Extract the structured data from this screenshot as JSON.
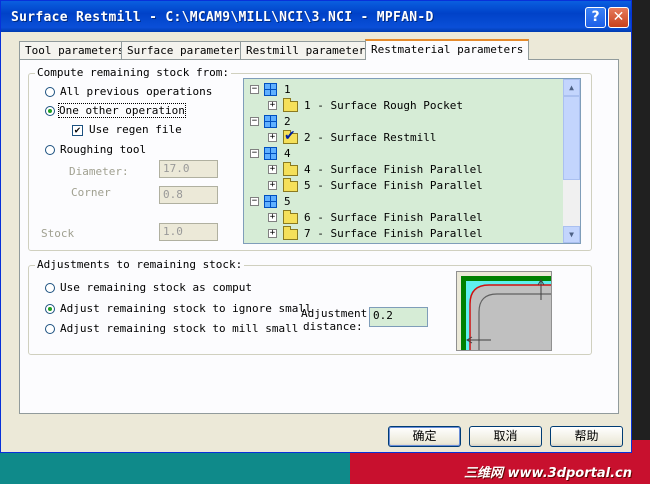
{
  "window": {
    "title": "Surface Restmill - C:\\MCAM9\\MILL\\NCI\\3.NCI - MPFAN-D",
    "help_glyph": "?",
    "close_glyph": "✕"
  },
  "tabs": [
    {
      "label": "Tool parameters",
      "active": false
    },
    {
      "label": "Surface parameters",
      "active": false
    },
    {
      "label": "Restmill parameters",
      "active": false
    },
    {
      "label": "Restmaterial parameters",
      "active": true
    }
  ],
  "compute_group": {
    "label": "Compute remaining stock from:",
    "options": [
      {
        "label": "All previous operations",
        "selected": false
      },
      {
        "label": "One other operation",
        "selected": true
      },
      {
        "label": "Roughing tool",
        "selected": false
      }
    ],
    "use_regen": {
      "label": "Use regen file",
      "checked": true
    },
    "diameter": {
      "label": "Diameter:",
      "value": "17.0"
    },
    "corner": {
      "label": "Corner",
      "value": "0.8"
    },
    "stock": {
      "label": "Stock",
      "value": "1.0"
    }
  },
  "tree": {
    "groups": [
      {
        "label": "1",
        "ops": [
          {
            "label": "1 - Surface Rough Pocket",
            "checked": false
          }
        ]
      },
      {
        "label": "2",
        "ops": [
          {
            "label": "2 - Surface Restmill",
            "checked": true
          }
        ]
      },
      {
        "label": "4",
        "ops": [
          {
            "label": "4 - Surface Finish Parallel",
            "checked": false
          },
          {
            "label": "5 - Surface Finish Parallel",
            "checked": false
          }
        ]
      },
      {
        "label": "5",
        "ops": [
          {
            "label": "6 - Surface Finish Parallel",
            "checked": false
          },
          {
            "label": "7 - Surface Finish Parallel",
            "checked": false
          }
        ]
      }
    ],
    "expander_plus": "+",
    "expander_minus": "−"
  },
  "adjust_group": {
    "label": "Adjustments to remaining stock:",
    "options": [
      {
        "label": "Use remaining stock as comput",
        "selected": false
      },
      {
        "label": "Adjust remaining stock to ignore small",
        "selected": true
      },
      {
        "label": "Adjust remaining stock to mill small",
        "selected": false
      }
    ],
    "distance_label_1": "Adjustment",
    "distance_label_2": "distance:",
    "distance_value": "0.2"
  },
  "buttons": {
    "ok": "确定",
    "cancel": "取消",
    "help": "帮助"
  },
  "watermark": "三维网 www.3dportal.cn",
  "colors": {
    "titlebar": "#0042c8",
    "tree_bg": "#d6ecd6",
    "accent_tab": "#e68b2c"
  }
}
